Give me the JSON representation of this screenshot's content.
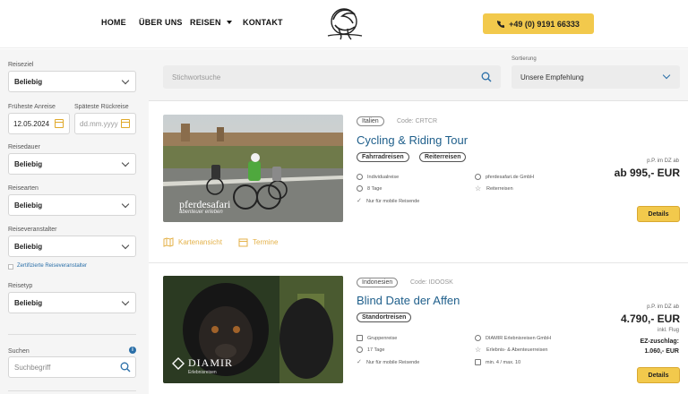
{
  "nav": {
    "items": [
      {
        "label": "HOME"
      },
      {
        "label": "ÜBER UNS"
      },
      {
        "label": "REISEN"
      },
      {
        "label": "KONTAKT"
      }
    ],
    "phone": "+49 (0) 9191 66333",
    "colors": {
      "accent": "#f2c94c",
      "link": "#1f5f8b"
    }
  },
  "filters": {
    "reiseziel": {
      "label": "Reiseziel",
      "value": "Beliebig"
    },
    "anreise": {
      "label": "Früheste Anreise",
      "value": "12.05.2024"
    },
    "rueckreise": {
      "label": "Späteste Rückreise",
      "placeholder": "dd.mm.yyyy"
    },
    "reisedauer": {
      "label": "Reisedauer",
      "value": "Beliebig"
    },
    "reisearten": {
      "label": "Reisearten",
      "value": "Beliebig"
    },
    "veranstalter": {
      "label": "Reiseveranstalter",
      "value": "Beliebig"
    },
    "zertifiziert": "Zertifizierte Reiseveranstalter",
    "reisetyp": {
      "label": "Reisetyp",
      "value": "Beliebig"
    },
    "suchen": {
      "label": "Suchen",
      "placeholder": "Suchbegriff"
    }
  },
  "search": {
    "keyword_placeholder": "Stichwortsuche",
    "sort_label": "Sortierung",
    "sort_value": "Unsere Empfehlung"
  },
  "results": [
    {
      "country": "Italien",
      "code": "Code: CRTCR",
      "title": "Cycling & Riding Tour",
      "tags": [
        "Fahrradreisen",
        "Reiterreisen"
      ],
      "attrs": [
        "Individualreise",
        "8 Tage",
        "Nur für mobile Reisende",
        "pferdesafari.de GmbH",
        "Reiterreisen"
      ],
      "image_caption": "pferdesafari",
      "image_caption_sub": "abenteuer erleben",
      "price_note": "p.P. im DZ ab",
      "price": "ab 995,- EUR",
      "details": "Details",
      "map_link": "Kartenansicht",
      "dates_link": "Termine"
    },
    {
      "country": "Indonesien",
      "code": "Code: IDOOSK",
      "title": "Blind Date der Affen",
      "tags": [
        "Standortreisen"
      ],
      "attrs": [
        "Gruppenreise",
        "17 Tage",
        "Nur für mobile Reisende",
        "DIAMIR Erlebnisreisen GmbH",
        "Erlebnis- & Abenteuerreisen",
        "min. 4 / max. 10"
      ],
      "image_caption": "DIAMIR",
      "image_caption_sub": "Erlebnisreisen",
      "price_note": "p.P. im DZ ab",
      "price": "4.790,- EUR",
      "price_extra": "inkl. Flug",
      "ez_label": "EZ-zuschlag:",
      "ez_value": "1.060,- EUR",
      "details": "Details"
    }
  ]
}
